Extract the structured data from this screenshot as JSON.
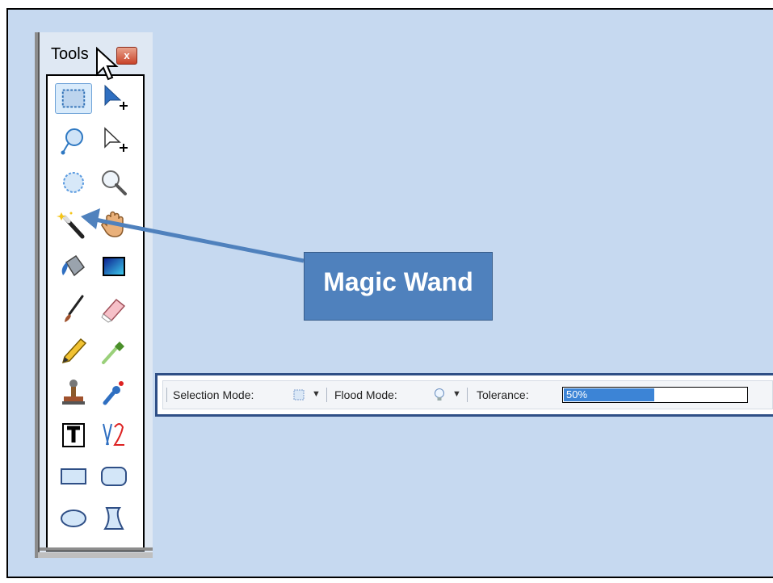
{
  "tools_window": {
    "title": "Tools",
    "close_glyph": "x",
    "tools": [
      {
        "name": "rectangle-select-tool",
        "icon": "rect-select-icon",
        "selected": true
      },
      {
        "name": "move-selected-pixels-tool",
        "icon": "move-pixels-icon"
      },
      {
        "name": "lasso-select-tool",
        "icon": "lasso-icon"
      },
      {
        "name": "move-selection-tool",
        "icon": "move-selection-icon"
      },
      {
        "name": "ellipse-select-tool",
        "icon": "ellipse-select-icon"
      },
      {
        "name": "zoom-tool",
        "icon": "zoom-icon"
      },
      {
        "name": "magic-wand-tool",
        "icon": "magic-wand-icon"
      },
      {
        "name": "pan-tool",
        "icon": "hand-icon"
      },
      {
        "name": "paint-bucket-tool",
        "icon": "paint-bucket-icon"
      },
      {
        "name": "gradient-tool",
        "icon": "gradient-icon"
      },
      {
        "name": "paintbrush-tool",
        "icon": "paintbrush-icon"
      },
      {
        "name": "eraser-tool",
        "icon": "eraser-icon"
      },
      {
        "name": "pencil-tool",
        "icon": "pencil-icon"
      },
      {
        "name": "color-picker-tool",
        "icon": "eyedropper-icon"
      },
      {
        "name": "clone-stamp-tool",
        "icon": "stamp-icon"
      },
      {
        "name": "recolor-tool",
        "icon": "recolor-icon"
      },
      {
        "name": "text-tool",
        "icon": "text-icon"
      },
      {
        "name": "line-curve-tool",
        "icon": "line-curve-icon"
      },
      {
        "name": "rectangle-tool",
        "icon": "rectangle-icon"
      },
      {
        "name": "rounded-rectangle-tool",
        "icon": "rounded-rectangle-icon"
      },
      {
        "name": "ellipse-tool",
        "icon": "ellipse-icon"
      },
      {
        "name": "freeform-shape-tool",
        "icon": "freeform-shape-icon"
      }
    ]
  },
  "toolbar": {
    "selection_mode_label": "Selection Mode:",
    "flood_mode_label": "Flood Mode:",
    "tolerance_label": "Tolerance:",
    "tolerance_value": "50%",
    "tolerance_fraction": 0.5
  },
  "callout": {
    "label": "Magic Wand"
  },
  "colors": {
    "slide_background": "#c6d9f0",
    "callout_fill": "#4f81bd",
    "arrow": "#4f81bd",
    "tolerance_fill": "#3c84d6"
  }
}
